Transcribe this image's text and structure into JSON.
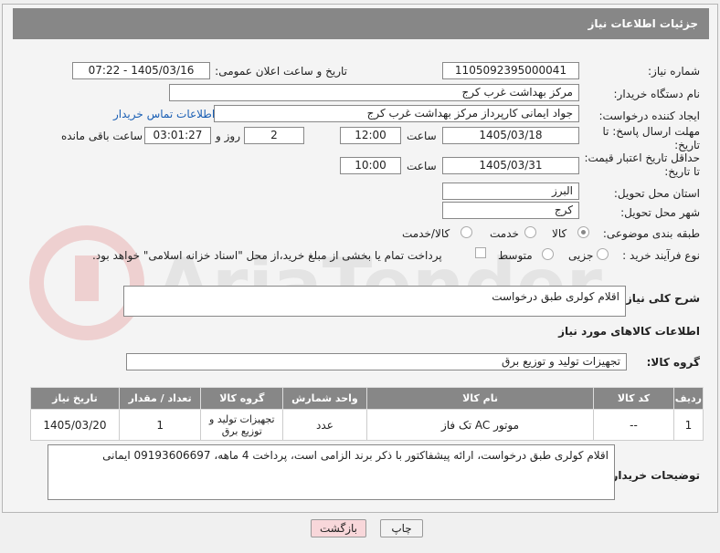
{
  "header": {
    "title": "جزئیات اطلاعات نیاز"
  },
  "fields": {
    "need_number_label": "شماره نیاز:",
    "need_number": "1105092395000041",
    "announce_label": "تاریخ و ساعت اعلان عمومی:",
    "announce_value": "1405/03/16 - 07:22",
    "buyer_label": "نام دستگاه خریدار:",
    "buyer_value": "مرکز بهداشت غرب کرج",
    "creator_label": "ایجاد کننده درخواست:",
    "creator_value": "جواد ایمانی کارپرداز مرکز بهداشت غرب کرج",
    "contact_link": "اطلاعات تماس خریدار",
    "deadline_label_1": "مهلت ارسال پاسخ: تا",
    "deadline_label_2": "تاریخ:",
    "deadline_date": "1405/03/18",
    "time_label": "ساعت",
    "deadline_time": "12:00",
    "days_value": "2",
    "days_label": "روز و",
    "remaining_time": "03:01:27",
    "remaining_label": "ساعت باقی مانده",
    "validity_label_1": "حداقل تاریخ اعتبار قیمت:",
    "validity_label_2": "تا تاریخ:",
    "validity_date": "1405/03/31",
    "validity_time": "10:00",
    "province_label": "استان محل تحویل:",
    "province_value": "البرز",
    "city_label": "شهر محل تحویل:",
    "city_value": "کرج",
    "category_label": "طبقه بندی موضوعی:",
    "category_options": [
      "کالا",
      "خدمت",
      "کالا/خدمت"
    ],
    "category_selected": "کالا",
    "process_label": "نوع فرآیند خرید :",
    "process_options": [
      "جزیی",
      "متوسط"
    ],
    "process_note": "پرداخت تمام یا بخشی از مبلغ خرید،از محل \"اسناد خزانه اسلامی\" خواهد بود.",
    "description_label": "شرح کلی نیاز:",
    "description_value": "اقلام کولری طبق درخواست",
    "goods_info_title": "اطلاعات کالاهای مورد نیاز",
    "goods_group_label": "گروه کالا:",
    "goods_group_value": "تجهیزات تولید و توزیع برق",
    "buyer_notes_label": "توضیحات خریدار:",
    "buyer_notes_value": "اقلام کولری طبق درخواست، ارائه پیشفاکتور با ذکر برند الزامی است، پرداخت 4 ماهه، 09193606697 ایمانی"
  },
  "table": {
    "headers": [
      "ردیف",
      "کد کالا",
      "نام کالا",
      "واحد شمارش",
      "گروه کالا",
      "تعداد / مقدار",
      "تاریخ نیاز"
    ],
    "rows": [
      [
        "1",
        "--",
        "موتور AC تک فاز",
        "عدد",
        "تجهیزات تولید و توزیع برق",
        "1",
        "1405/03/20"
      ]
    ]
  },
  "buttons": {
    "print": "چاپ",
    "back": "بازگشت"
  },
  "watermark": {
    "text": "AriaTender.neT"
  },
  "colors": {
    "header_bg": "#878787",
    "link": "#1a5fb4",
    "back_button_bg": "#f8d7da"
  }
}
